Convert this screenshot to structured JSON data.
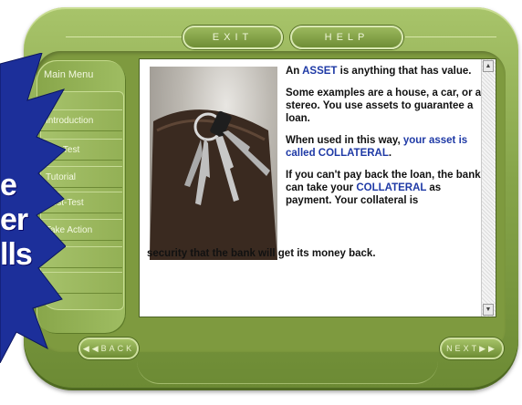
{
  "nav": {
    "exit_label": "EXIT",
    "help_label": "HELP",
    "back_label": "BACK",
    "next_label": "NEXT"
  },
  "menu": {
    "title": "Main Menu",
    "items": [
      "Introduction",
      "Pre-Test",
      "Tutorial",
      "Post-Test",
      "Take Action"
    ]
  },
  "overlay": {
    "lines": [
      "e",
      "er",
      "lls"
    ]
  },
  "content": {
    "p1_pre": "An ",
    "p1_hl": "ASSET",
    "p1_post": " is anything that has value.",
    "p2": "Some examples are a house, a car, or a stereo. You use assets to guarantee a loan.",
    "p3_pre": "When used in this way, ",
    "p3_hl": "your asset is called COLLATERAL",
    "p3_post": ".",
    "p4_pre": "If you can't pay back the loan, the bank can take your ",
    "p4_hl": "COLLATERAL",
    "p4_post": " as payment.  Your collateral is",
    "p4_tail": "security that the bank will get its money back."
  },
  "colors": {
    "frame": "#86a44a",
    "highlight": "#1f3aa6",
    "burst": "#1c2f9a"
  },
  "icons": {
    "back": "back-chevron-icon",
    "next": "next-chevron-icon",
    "scroll_up": "scroll-up-icon",
    "scroll_down": "scroll-down-icon"
  }
}
